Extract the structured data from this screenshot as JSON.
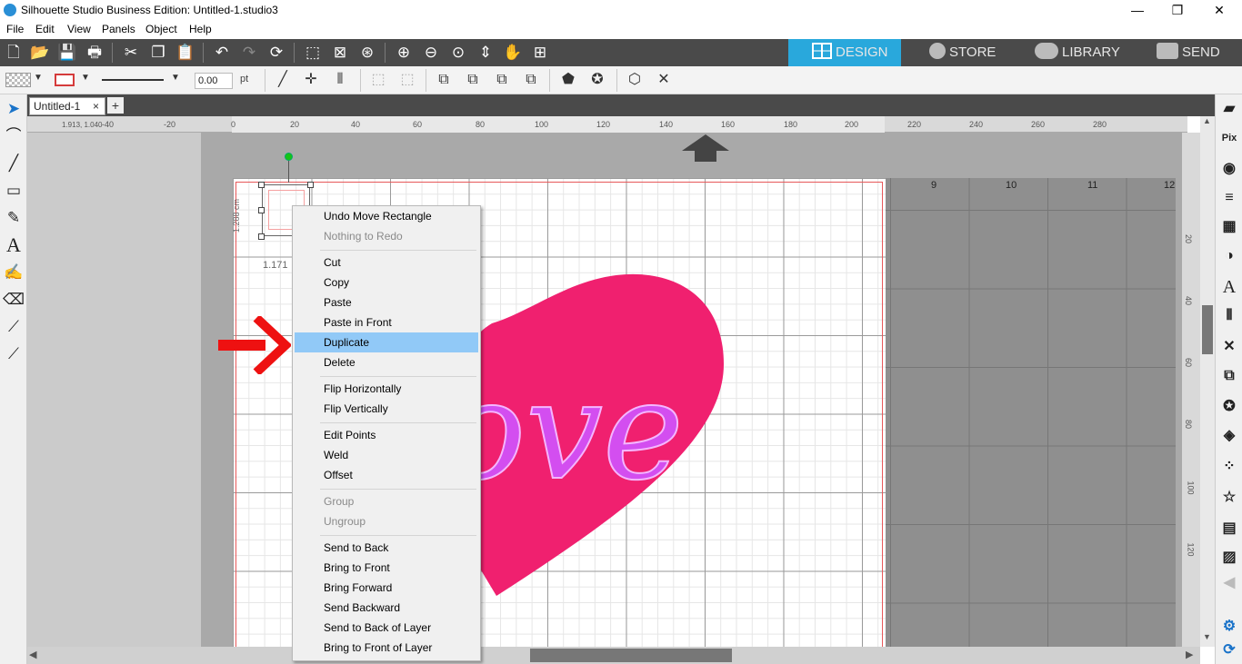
{
  "window": {
    "title": "Silhouette Studio Business Edition: Untitled-1.studio3",
    "min_glyph": "—",
    "max_glyph": "❐",
    "close_glyph": "✕"
  },
  "menu": [
    "File",
    "Edit",
    "View",
    "Panels",
    "Object",
    "Help"
  ],
  "nav_tabs": [
    {
      "label": "DESIGN",
      "active": true,
      "icon": "grid-icon"
    },
    {
      "label": "STORE",
      "active": false,
      "icon": "s-logo-icon"
    },
    {
      "label": "LIBRARY",
      "active": false,
      "icon": "cloud-icon"
    },
    {
      "label": "SEND",
      "active": false,
      "icon": "printer-icon"
    }
  ],
  "line_width": {
    "value": "0.00",
    "unit": "pt"
  },
  "doc_tab": {
    "label": "Untitled-1",
    "close": "×",
    "add": "+"
  },
  "ruler": {
    "coord": "1.913, 1.040",
    "h_ticks": [
      "-40",
      "-20",
      "0",
      "20",
      "40",
      "60",
      "80",
      "100",
      "120",
      "140",
      "160",
      "180",
      "200",
      "220",
      "240",
      "260",
      "280"
    ],
    "v_ticks": [
      "20",
      "40",
      "60",
      "80",
      "100",
      "120"
    ]
  },
  "mat_columns": [
    "9",
    "10",
    "11",
    "12"
  ],
  "selection": {
    "height_label": "1.288 cm",
    "width_label": "1.171"
  },
  "artwork_text": "ove",
  "annotation": {
    "arrow": "red-arrow"
  },
  "context_menu": {
    "items": [
      {
        "label": "Undo Move Rectangle",
        "disabled": false
      },
      {
        "label": "Nothing to Redo",
        "disabled": true
      },
      {
        "label": "Cut",
        "disabled": false
      },
      {
        "label": "Copy",
        "disabled": false
      },
      {
        "label": "Paste",
        "disabled": false
      },
      {
        "label": "Paste in Front",
        "disabled": false
      },
      {
        "label": "Duplicate",
        "disabled": false,
        "highlighted": true
      },
      {
        "label": "Delete",
        "disabled": false
      },
      {
        "label": "Flip Horizontally",
        "disabled": false
      },
      {
        "label": "Flip Vertically",
        "disabled": false
      },
      {
        "label": "Edit Points",
        "disabled": false
      },
      {
        "label": "Weld",
        "disabled": false
      },
      {
        "label": "Offset",
        "disabled": false
      },
      {
        "label": "Group",
        "disabled": true
      },
      {
        "label": "Ungroup",
        "disabled": true
      },
      {
        "label": "Send to Back",
        "disabled": false
      },
      {
        "label": "Bring to Front",
        "disabled": false
      },
      {
        "label": "Bring Forward",
        "disabled": false
      },
      {
        "label": "Send Backward",
        "disabled": false
      },
      {
        "label": "Send to Back of Layer",
        "disabled": false
      },
      {
        "label": "Bring to Front of Layer",
        "disabled": false
      }
    ]
  },
  "colors": {
    "heart": "#f0206f",
    "letters": "#d34ef0",
    "highlight": "#91c9f7",
    "design_tab": "#29a8dc",
    "toolbar": "#4a4a4a"
  }
}
